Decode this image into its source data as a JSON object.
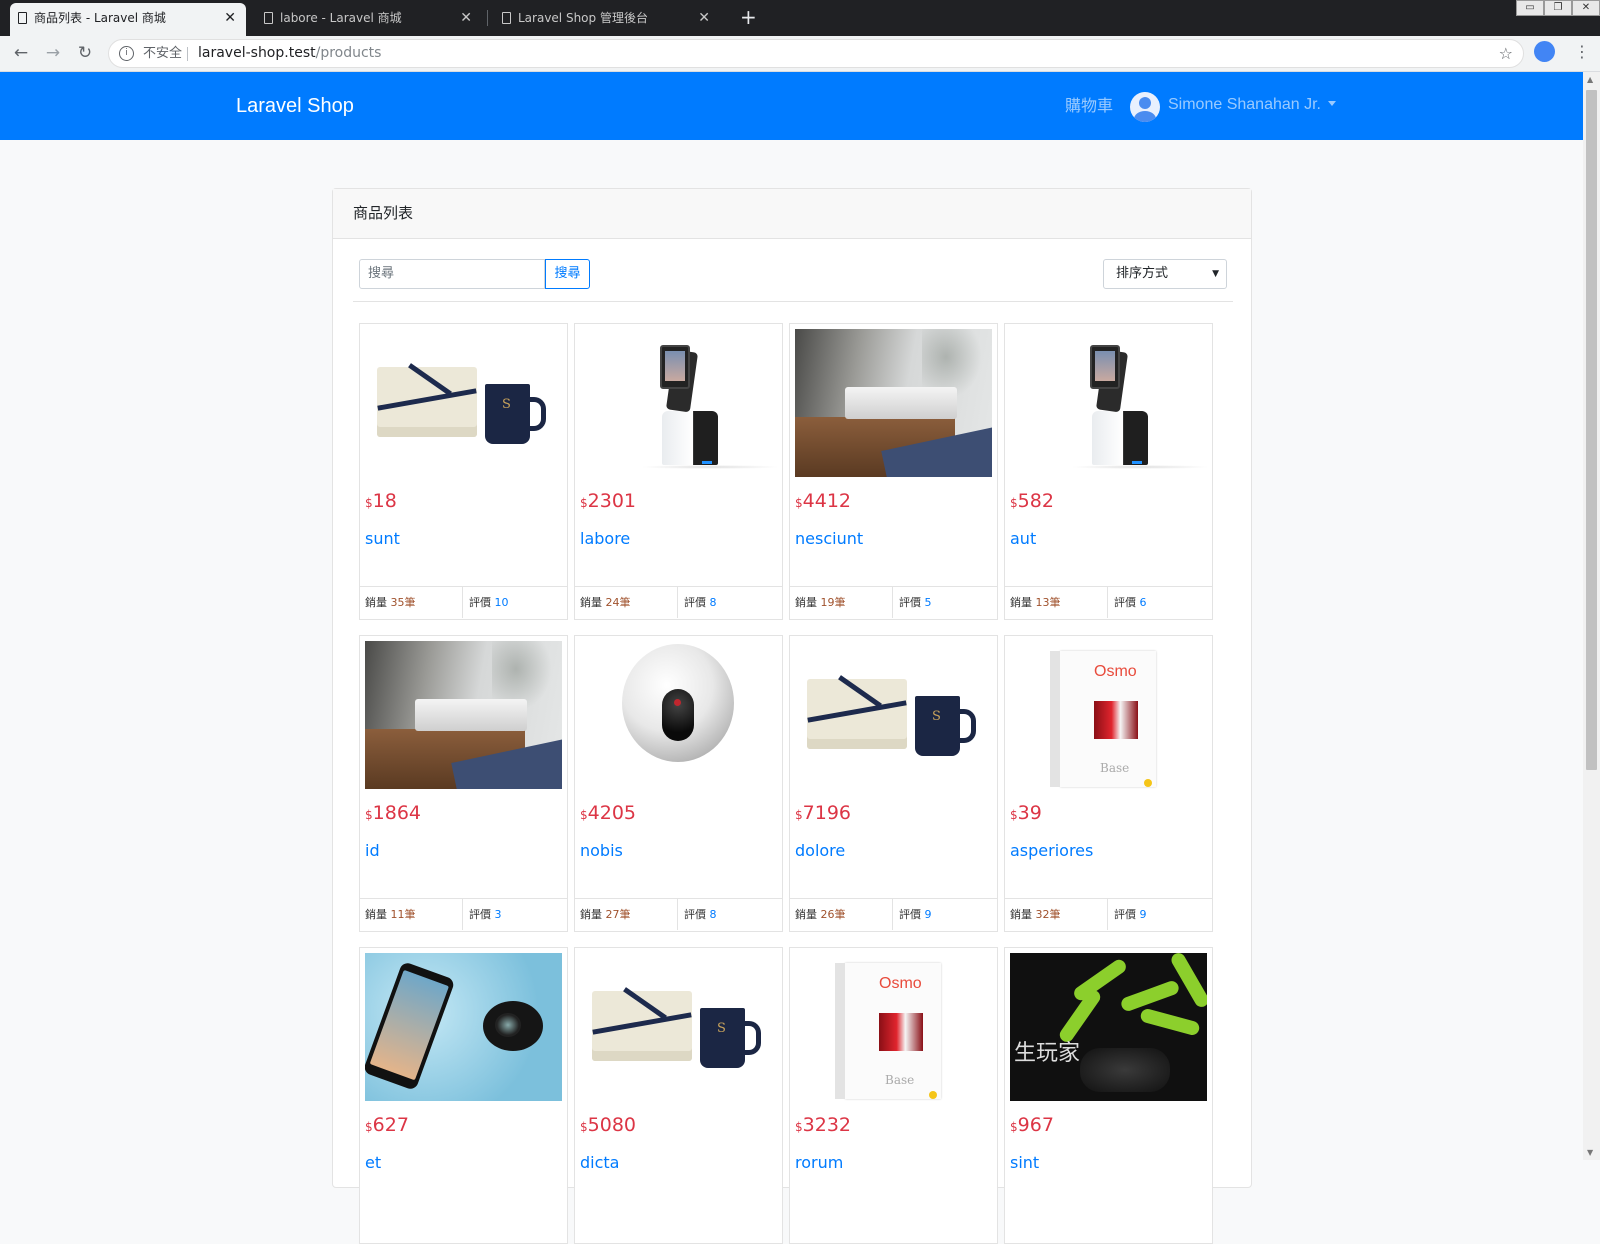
{
  "browser": {
    "tabs": [
      {
        "title": "商品列表 - Laravel 商城",
        "active": true
      },
      {
        "title": "labore - Laravel 商城",
        "active": false
      },
      {
        "title": "Laravel Shop 管理後台",
        "active": false
      }
    ],
    "new_tab": "+",
    "close": "✕",
    "security": "不安全",
    "url_host": "laravel-shop.test",
    "url_path": "/products",
    "window_controls": [
      "▭",
      "❐",
      "✕"
    ]
  },
  "navbar": {
    "brand": "Laravel Shop",
    "cart": "購物車",
    "user_name": "Simone Shanahan Jr."
  },
  "card": {
    "header": "商品列表"
  },
  "filters": {
    "search_placeholder": "搜尋",
    "search_button": "搜尋",
    "sort_label": "排序方式"
  },
  "labels": {
    "currency": "$",
    "sold": "銷量",
    "sold_unit": "筆",
    "review": "評價"
  },
  "products": [
    {
      "price": "18",
      "title": "sunt",
      "sold": "35",
      "reviews": "10",
      "image": "gift-box-mug"
    },
    {
      "price": "2301",
      "title": "labore",
      "sold": "24",
      "reviews": "8",
      "image": "tablet-robot"
    },
    {
      "price": "4412",
      "title": "nesciunt",
      "sold": "19",
      "reviews": "5",
      "image": "speaker"
    },
    {
      "price": "582",
      "title": "aut",
      "sold": "13",
      "reviews": "6",
      "image": "tablet-robot"
    },
    {
      "price": "1864",
      "title": "id",
      "sold": "11",
      "reviews": "3",
      "image": "speaker"
    },
    {
      "price": "4205",
      "title": "nobis",
      "sold": "27",
      "reviews": "8",
      "image": "camera-ball"
    },
    {
      "price": "7196",
      "title": "dolore",
      "sold": "26",
      "reviews": "9",
      "image": "gift-box-mug"
    },
    {
      "price": "39",
      "title": "asperiores",
      "sold": "32",
      "reviews": "9",
      "image": "osmo-base"
    },
    {
      "price": "627",
      "title": "et",
      "image": "phone-lens"
    },
    {
      "price": "5080",
      "title": "dicta",
      "image": "gift-box-mug"
    },
    {
      "price": "3232",
      "title": "rorum",
      "image": "osmo-base"
    },
    {
      "price": "967",
      "title": "sint",
      "image": "drone"
    }
  ],
  "osmo_art": {
    "logo": "Osmo",
    "base": "Base"
  },
  "drone_art": {
    "text": "生玩家"
  },
  "mug_art": {
    "letter": "S"
  }
}
